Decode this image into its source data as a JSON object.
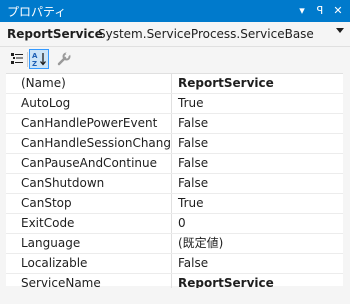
{
  "window": {
    "title": "プロパティ",
    "buttons": [
      "▾",
      "ꟼ",
      "✕"
    ]
  },
  "object_selector": {
    "name": "ReportService",
    "type": "System.ServiceProcess.ServiceBase"
  },
  "toolbar": {
    "categorized_icon": "categorized-icon",
    "alphabetical_icon": "alphabetical-icon",
    "property_pages_icon": "wrench-icon",
    "active": "alphabetical"
  },
  "properties": [
    {
      "name": "(Name)",
      "value": "ReportService",
      "bold": true
    },
    {
      "name": "AutoLog",
      "value": "True",
      "bold": false
    },
    {
      "name": "CanHandlePowerEvent",
      "value": "False",
      "bold": false
    },
    {
      "name": "CanHandleSessionChangeEvent",
      "value": "False",
      "bold": false
    },
    {
      "name": "CanPauseAndContinue",
      "value": "False",
      "bold": false
    },
    {
      "name": "CanShutdown",
      "value": "False",
      "bold": false
    },
    {
      "name": "CanStop",
      "value": "True",
      "bold": false
    },
    {
      "name": "ExitCode",
      "value": "0",
      "bold": false
    },
    {
      "name": "Language",
      "value": "(既定値)",
      "bold": false
    },
    {
      "name": "Localizable",
      "value": "False",
      "bold": false
    },
    {
      "name": "ServiceName",
      "value": "ReportService",
      "bold": true
    }
  ],
  "colors": {
    "title_bar": "#007acc",
    "active_button": "#cce4f7",
    "active_border": "#3399ff"
  }
}
